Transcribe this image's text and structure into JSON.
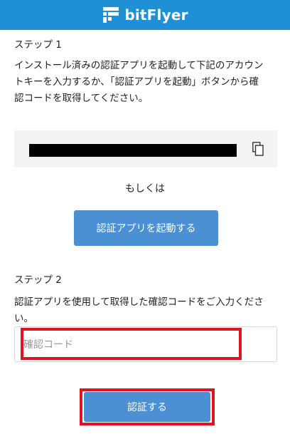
{
  "header": {
    "brand": "bitFlyer",
    "logo_icon": "bitflyer-logo-icon"
  },
  "step1": {
    "title": "ステップ 1",
    "description_line1": "インストール済みの認証アプリを起動して下記のアカウン",
    "description_line2": "トキーを入力するか、「認証アプリを起動」ボタンから確",
    "description_line3": "認コードを取得してください。"
  },
  "key_box": {
    "copy_icon": "copy-icon"
  },
  "or_label": "もしくは",
  "launch_button_label": "認証アプリを起動する",
  "step2": {
    "title": "ステップ 2",
    "description_line1": "認証アプリを使用して取得した確認コードをご入力くださ",
    "description_line2": "い。"
  },
  "code_input": {
    "value": "",
    "placeholder": "確認コード"
  },
  "submit_button_label": "認証する",
  "colors": {
    "header": "#1f8fd6",
    "button": "#4a90d2",
    "highlight": "#e0141e"
  }
}
